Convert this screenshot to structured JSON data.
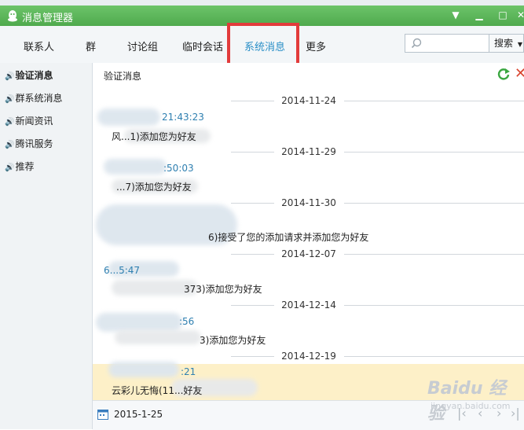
{
  "window": {
    "title": "消息管理器"
  },
  "tabs": [
    {
      "label": "联系人"
    },
    {
      "label": "群"
    },
    {
      "label": "讨论组"
    },
    {
      "label": "临时会话"
    },
    {
      "label": "系统消息"
    },
    {
      "label": "更多"
    }
  ],
  "active_tab": "系统消息",
  "search": {
    "placeholder": "",
    "button": "搜索"
  },
  "sidebar": {
    "items": [
      {
        "label": "验证消息",
        "selected": true
      },
      {
        "label": "群系统消息"
      },
      {
        "label": "新闻资讯"
      },
      {
        "label": "腾讯服务"
      },
      {
        "label": "推荐"
      }
    ]
  },
  "main": {
    "section_title": "验证消息",
    "groups": [
      {
        "date": "2014-11-24",
        "time": "21:43:23",
        "text": "风...1)添加您为好友"
      },
      {
        "date": "2014-11-29",
        "time": ":50:03",
        "text": "...7)添加您为好友"
      },
      {
        "date": "2014-11-30",
        "time": "",
        "text": "6)接受了您的添加请求并添加您为好友"
      },
      {
        "date": "2014-12-07",
        "time": "6...5:47",
        "text": "373)添加您为好友"
      },
      {
        "date": "2014-12-14",
        "time": ":56",
        "text": "3)添加您为好友"
      },
      {
        "date": "2014-12-19",
        "time": ":21",
        "text": "云彩儿无悔(11...好友"
      }
    ]
  },
  "footer": {
    "date": "2015-1-25"
  },
  "watermark": {
    "brand": "Baidu 经验",
    "url": "jingyan.baidu.com"
  },
  "colors": {
    "title_green": "#5cb85c",
    "accent_blue": "#2a8fc7",
    "highlight_red": "#e23b3b",
    "selected_row": "#fdf0c8"
  }
}
